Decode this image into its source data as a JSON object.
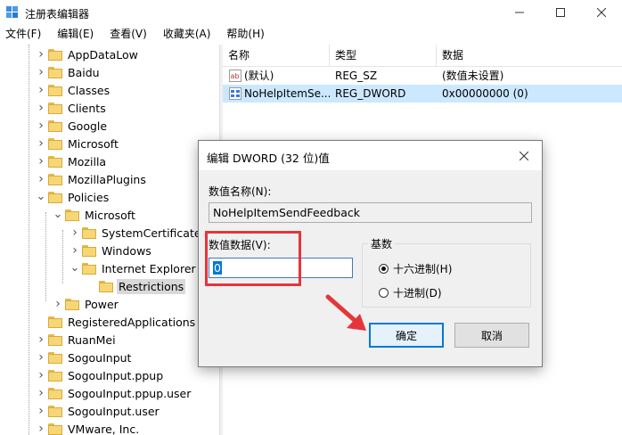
{
  "window": {
    "title": "注册表编辑器"
  },
  "menu": [
    {
      "label": "文件(F)"
    },
    {
      "label": "编辑(E)"
    },
    {
      "label": "查看(V)"
    },
    {
      "label": "收藏夹(A)"
    },
    {
      "label": "帮助(H)"
    }
  ],
  "tree": [
    {
      "label": "AppDataLow",
      "expanded": false,
      "selected": false
    },
    {
      "label": "Baidu",
      "expanded": false,
      "selected": false
    },
    {
      "label": "Classes",
      "expanded": false,
      "selected": false
    },
    {
      "label": "Clients",
      "expanded": false,
      "selected": false
    },
    {
      "label": "Google",
      "expanded": false,
      "selected": false
    },
    {
      "label": "Microsoft",
      "expanded": false,
      "selected": false
    },
    {
      "label": "Mozilla",
      "expanded": false,
      "selected": false
    },
    {
      "label": "MozillaPlugins",
      "expanded": false,
      "selected": false
    },
    {
      "label": "Policies",
      "expanded": true,
      "selected": false
    },
    {
      "label": "Microsoft",
      "expanded": true,
      "selected": false
    },
    {
      "label": "SystemCertificates",
      "expanded": false,
      "selected": false
    },
    {
      "label": "Windows",
      "expanded": false,
      "selected": false
    },
    {
      "label": "Internet Explorer",
      "expanded": true,
      "selected": false
    },
    {
      "label": "Restrictions",
      "expanded": null,
      "selected": true
    },
    {
      "label": "Power",
      "expanded": false,
      "selected": false
    },
    {
      "label": "RegisteredApplications",
      "expanded": null,
      "selected": false
    },
    {
      "label": "RuanMei",
      "expanded": false,
      "selected": false
    },
    {
      "label": "SogouInput",
      "expanded": false,
      "selected": false
    },
    {
      "label": "SogouInput.ppup",
      "expanded": false,
      "selected": false
    },
    {
      "label": "SogouInput.ppup.user",
      "expanded": false,
      "selected": false
    },
    {
      "label": "SogouInput.user",
      "expanded": false,
      "selected": false
    },
    {
      "label": "VMware, Inc.",
      "expanded": false,
      "selected": false
    }
  ],
  "list": {
    "columns": [
      "名称",
      "类型",
      "数据"
    ],
    "rows": [
      {
        "icon": "string-value-icon",
        "name": "(默认)",
        "type": "REG_SZ",
        "data": "(数值未设置)",
        "selected": false
      },
      {
        "icon": "binary-value-icon",
        "name": "NoHelpItemSe...",
        "type": "REG_DWORD",
        "data": "0x00000000 (0)",
        "selected": true
      }
    ]
  },
  "dialog": {
    "title": "编辑 DWORD (32 位)值",
    "name_label": "数值名称(N):",
    "name_value": "NoHelpItemSendFeedback",
    "data_label": "数值数据(V):",
    "data_value": "0",
    "base_label": "基数",
    "radio_hex": "十六进制(H)",
    "radio_dec": "十进制(D)",
    "selected_base": "hex",
    "ok_label": "确定",
    "cancel_label": "取消"
  },
  "colors": {
    "selection": "#cce8ff",
    "accent": "#0078d7",
    "annotation": "#e5353b"
  }
}
